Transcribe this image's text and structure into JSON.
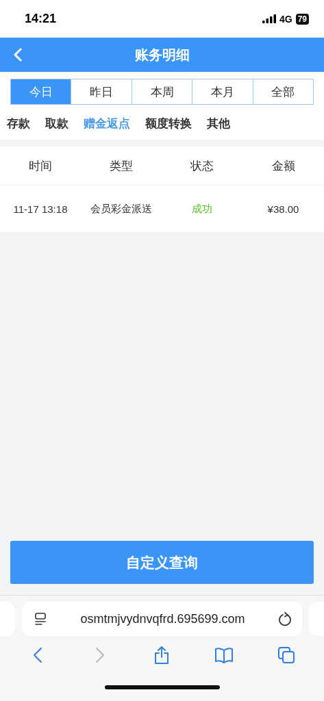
{
  "status_bar": {
    "time": "14:21",
    "network": "4G",
    "battery": "79"
  },
  "header": {
    "title": "账务明细"
  },
  "period_tabs": [
    {
      "label": "今日",
      "selected": true
    },
    {
      "label": "昨日",
      "selected": false
    },
    {
      "label": "本周",
      "selected": false
    },
    {
      "label": "本月",
      "selected": false
    },
    {
      "label": "全部",
      "selected": false
    }
  ],
  "category_tabs": [
    {
      "label": "存款",
      "selected": false
    },
    {
      "label": "取款",
      "selected": false
    },
    {
      "label": "赠金返点",
      "selected": true
    },
    {
      "label": "额度转换",
      "selected": false
    },
    {
      "label": "其他",
      "selected": false
    }
  ],
  "table": {
    "columns": [
      "时间",
      "类型",
      "状态",
      "金额"
    ],
    "rows": [
      {
        "time": "11-17 13:18",
        "type": "会员彩金派送",
        "status": "成功",
        "success": true,
        "amount": "¥38.00"
      }
    ]
  },
  "query_button": "自定义查询",
  "browser": {
    "url": "osmtmjvydnvqfrd.695699.com",
    "toolbar": [
      {
        "kind": "back",
        "disabled": false
      },
      {
        "kind": "forward",
        "disabled": true
      },
      {
        "kind": "share",
        "disabled": false
      },
      {
        "kind": "bookmarks",
        "disabled": false
      },
      {
        "kind": "tabs",
        "disabled": false
      }
    ]
  }
}
